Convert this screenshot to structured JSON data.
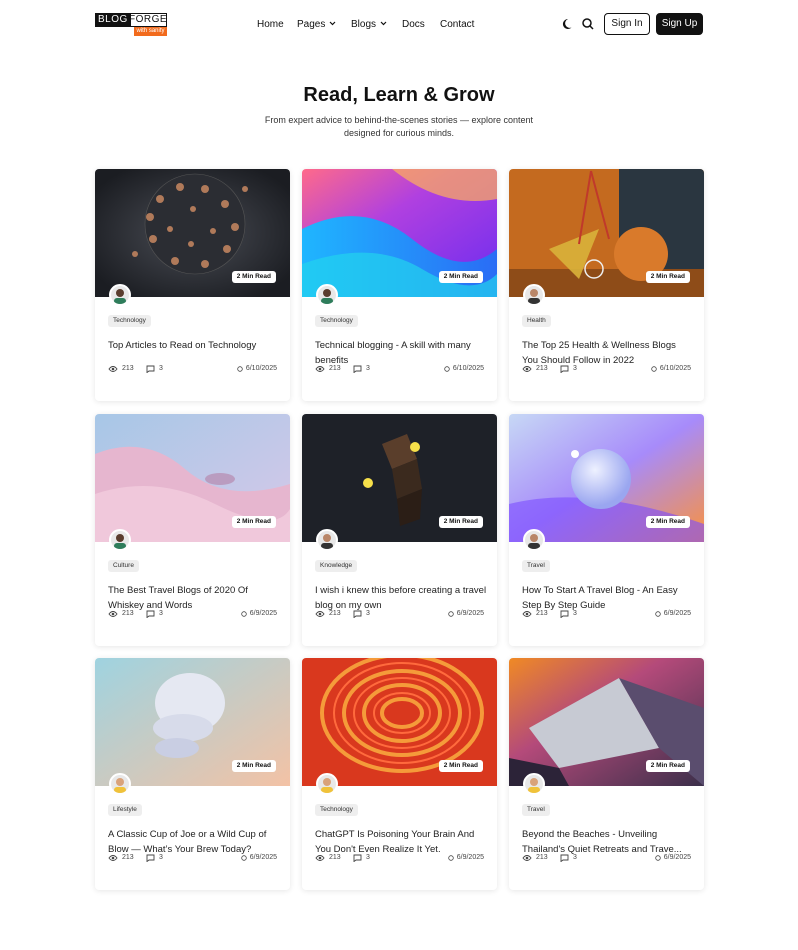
{
  "brand": {
    "word1": "BLOG",
    "word2": "FORGE",
    "tagline": "with sanity"
  },
  "nav": {
    "items": [
      {
        "label": "Home",
        "has_dropdown": false
      },
      {
        "label": "Pages",
        "has_dropdown": true
      },
      {
        "label": "Blogs",
        "has_dropdown": true
      },
      {
        "label": "Docs",
        "has_dropdown": false
      },
      {
        "label": "Contact",
        "has_dropdown": false
      }
    ],
    "theme_icon": "moon-icon",
    "search_icon": "search-icon",
    "signin_label": "Sign In",
    "signup_label": "Sign Up"
  },
  "hero": {
    "title": "Read, Learn & Grow",
    "subtitle": "From expert advice to behind-the-scenes stories — explore content designed for curious minds."
  },
  "colors": {
    "accent": "#f26b1d",
    "dark": "#111111",
    "tag_bg": "#eeeeee"
  },
  "cards": [
    {
      "read_time": "2 Min Read",
      "tag": "Technology",
      "title": "Top Articles to Read on Technology",
      "views": "213",
      "comments": "3",
      "date": "6/10/2025"
    },
    {
      "read_time": "2 Min Read",
      "tag": "Technology",
      "title": "Technical blogging - A skill with many benefits",
      "views": "213",
      "comments": "3",
      "date": "6/10/2025"
    },
    {
      "read_time": "2 Min Read",
      "tag": "Health",
      "title": "The Top 25 Health & Wellness Blogs You Should Follow in 2022",
      "views": "213",
      "comments": "3",
      "date": "6/10/2025"
    },
    {
      "read_time": "2 Min Read",
      "tag": "Culture",
      "title": "The Best Travel Blogs of 2020 Of Whiskey and Words",
      "views": "213",
      "comments": "3",
      "date": "6/9/2025"
    },
    {
      "read_time": "2 Min Read",
      "tag": "Knowledge",
      "title": "I wish i knew this before creating a travel blog on my own",
      "views": "213",
      "comments": "3",
      "date": "6/9/2025"
    },
    {
      "read_time": "2 Min Read",
      "tag": "Travel",
      "title": "How To Start A Travel Blog - An Easy Step By Step Guide",
      "views": "213",
      "comments": "3",
      "date": "6/9/2025"
    },
    {
      "read_time": "2 Min Read",
      "tag": "Lifestyle",
      "title": "A Classic Cup of Joe or a Wild Cup of Blow — What’s Your Brew Today?",
      "views": "213",
      "comments": "3",
      "date": "6/9/2025"
    },
    {
      "read_time": "2 Min Read",
      "tag": "Technology",
      "title": "ChatGPT Is Poisoning Your Brain And You Don't Even Realize It Yet.",
      "views": "213",
      "comments": "3",
      "date": "6/9/2025"
    },
    {
      "read_time": "2 Min Read",
      "tag": "Travel",
      "title": "Beyond the Beaches - Unveiling Thailand's Quiet Retreats and Trave...",
      "views": "213",
      "comments": "3",
      "date": "6/9/2025"
    }
  ]
}
